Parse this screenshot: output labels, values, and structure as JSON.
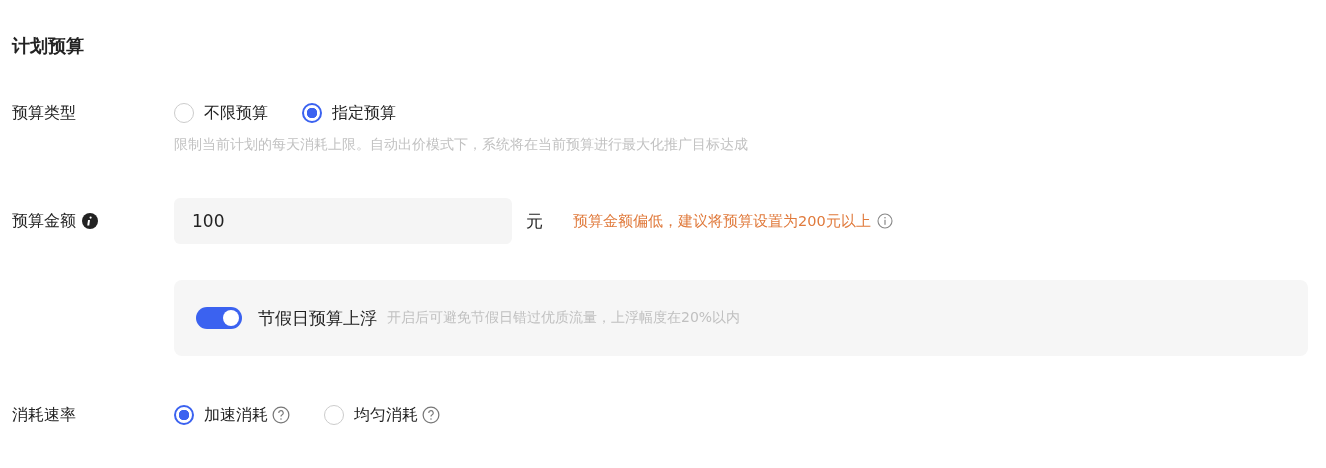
{
  "section_title": "计划预算",
  "budget_type": {
    "label": "预算类型",
    "options": [
      {
        "label": "不限预算",
        "selected": false,
        "help_icon": false
      },
      {
        "label": "指定预算",
        "selected": true,
        "help_icon": false
      }
    ],
    "hint": "限制当前计划的每天消耗上限。自动出价模式下，系统将在当前预算进行最大化推广目标达成"
  },
  "budget_amount": {
    "label": "预算金额",
    "value": "100",
    "unit": "元",
    "warning": "预算金额偏低，建议将预算设置为200元以上"
  },
  "holiday_float": {
    "on": true,
    "label": "节假日预算上浮",
    "hint": "开启后可避免节假日错过优质流量，上浮幅度在20%以内"
  },
  "spend_rate": {
    "label": "消耗速率",
    "options": [
      {
        "label": "加速消耗",
        "selected": true,
        "help_icon": true
      },
      {
        "label": "均匀消耗",
        "selected": false,
        "help_icon": true
      }
    ]
  }
}
